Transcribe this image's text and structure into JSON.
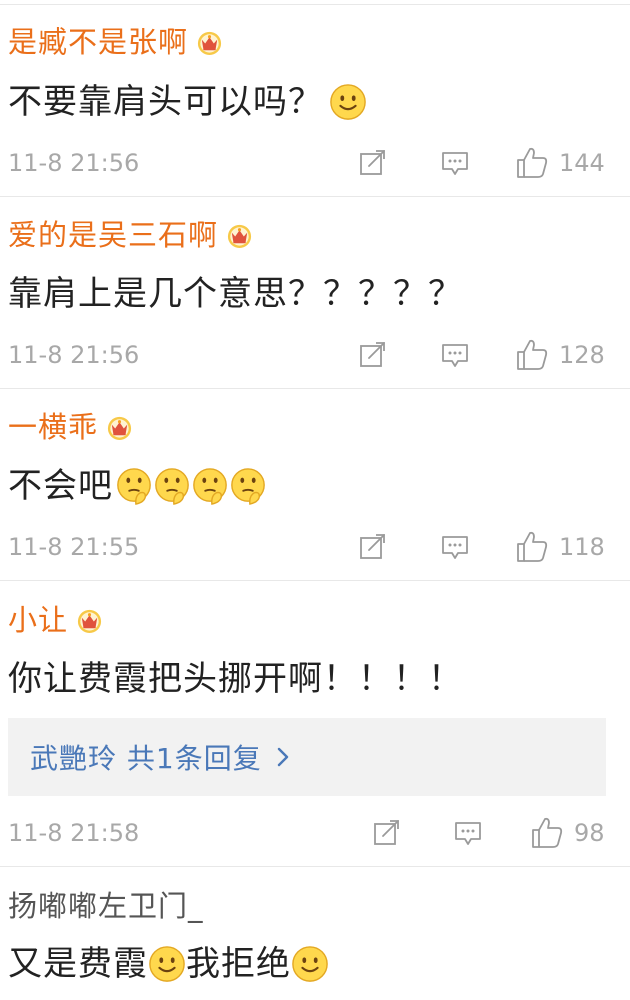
{
  "comments": [
    {
      "username": "是臧不是张啊",
      "badge": "crown-badge-icon",
      "text": "不要靠肩头可以吗？",
      "emojis": [
        "smile-emoji"
      ],
      "time": "11-8 21:56",
      "likes": "144"
    },
    {
      "username": "爱的是吴三石啊",
      "badge": "crown-badge-icon",
      "text": "靠肩上是几个意思？？？？？",
      "emojis": [],
      "time": "11-8 21:56",
      "likes": "128"
    },
    {
      "username": "一横乖",
      "badge": "crown-badge-icon",
      "text": "不会吧",
      "emojis": [
        "thinking-emoji",
        "thinking-emoji",
        "thinking-emoji",
        "thinking-emoji"
      ],
      "time": "11-8 21:55",
      "likes": "118"
    },
    {
      "username": "小让",
      "badge": "crown-badge-icon",
      "text": "你让费霞把头挪开啊！！！！",
      "emojis": [],
      "reply_summary": "武艷玲  共1条回复",
      "time": "11-8 21:58",
      "likes": "98"
    },
    {
      "username": "扬嘟嘟左卫门_",
      "text_before": "又是费霞",
      "text_after": "我拒绝",
      "emojis": [
        "smile-emoji",
        "smile-emoji"
      ]
    }
  ],
  "colors": {
    "username": "#ea6f1a",
    "plain_username": "#555555",
    "meta": "#a8a8a8",
    "reply_link": "#4a78b8",
    "reply_bg": "#f2f2f2"
  }
}
